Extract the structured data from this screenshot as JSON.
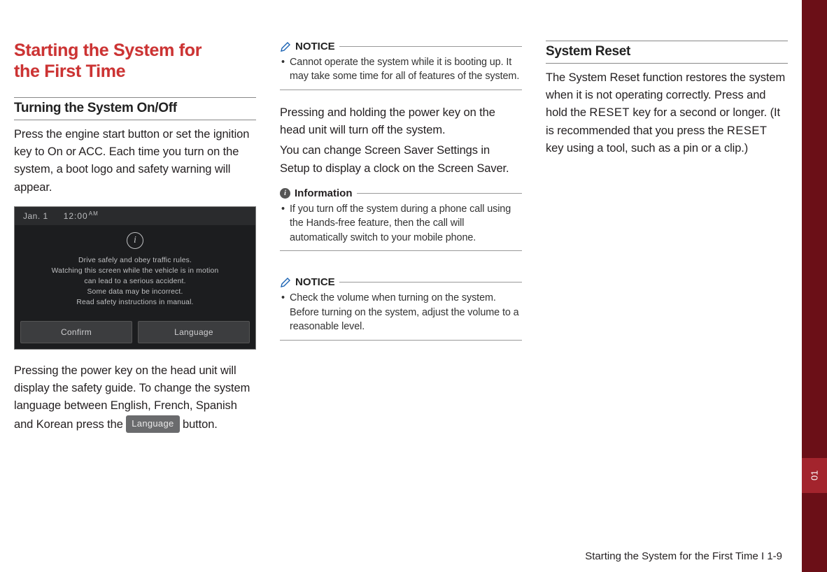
{
  "sidebar": {
    "tab": "01"
  },
  "heading": {
    "line1": "Starting the System for",
    "line2": "the First Time"
  },
  "col1": {
    "h2": "Turning the System On/Off",
    "p1": "Press the engine start button or set the ignition key to On or ACC. Each time you turn on the system, a boot logo and safety warning will appear.",
    "shot": {
      "date": "Jan. 1",
      "time": "12:00",
      "ampm": "AM",
      "msg1": "Drive safely and obey traffic rules.",
      "msg2": "Watching this screen while the vehicle is in motion",
      "msg3": "can lead to a serious accident.",
      "msg4": "Some data may be incorrect.",
      "msg5": "Read safety instructions in manual.",
      "btnConfirm": "Confirm",
      "btnLanguage": "Language"
    },
    "p2a": "Pressing the power key on the head unit will display the safety guide. To change the system language between English, French, Spanish and Korean press the ",
    "langBtn": "Language",
    "p2b": " button."
  },
  "col2": {
    "notice1Label": "NOTICE",
    "notice1Item": "Cannot operate the system while it is booting up. It may take some time for all of features of the system.",
    "p1": "Pressing and holding the power key on the head unit will turn off the system.",
    "p2": "You can change Screen Saver Settings in Setup to display a clock on the Screen Saver.",
    "infoLabel": "Information",
    "infoItem": "If you turn off the system during a phone call using the Hands-free feature, then the call will automatically switch to your mobile phone.",
    "notice2Label": "NOTICE",
    "notice2Item": "Check the volume when turning on the system. Before turning on the system, adjust the volume to a reasonable level."
  },
  "col3": {
    "h2": "System Reset",
    "p1a": "The System Reset function restores the system when it is not operating correctly. Press and hold the ",
    "reset1": "RESET",
    "p1b": " key for a second or longer. (It is recommended that you press the ",
    "reset2": "RESET",
    "p1c": " key using a tool, such as a pin or a clip.)"
  },
  "footer": "Starting the System for the First Time I 1-9"
}
